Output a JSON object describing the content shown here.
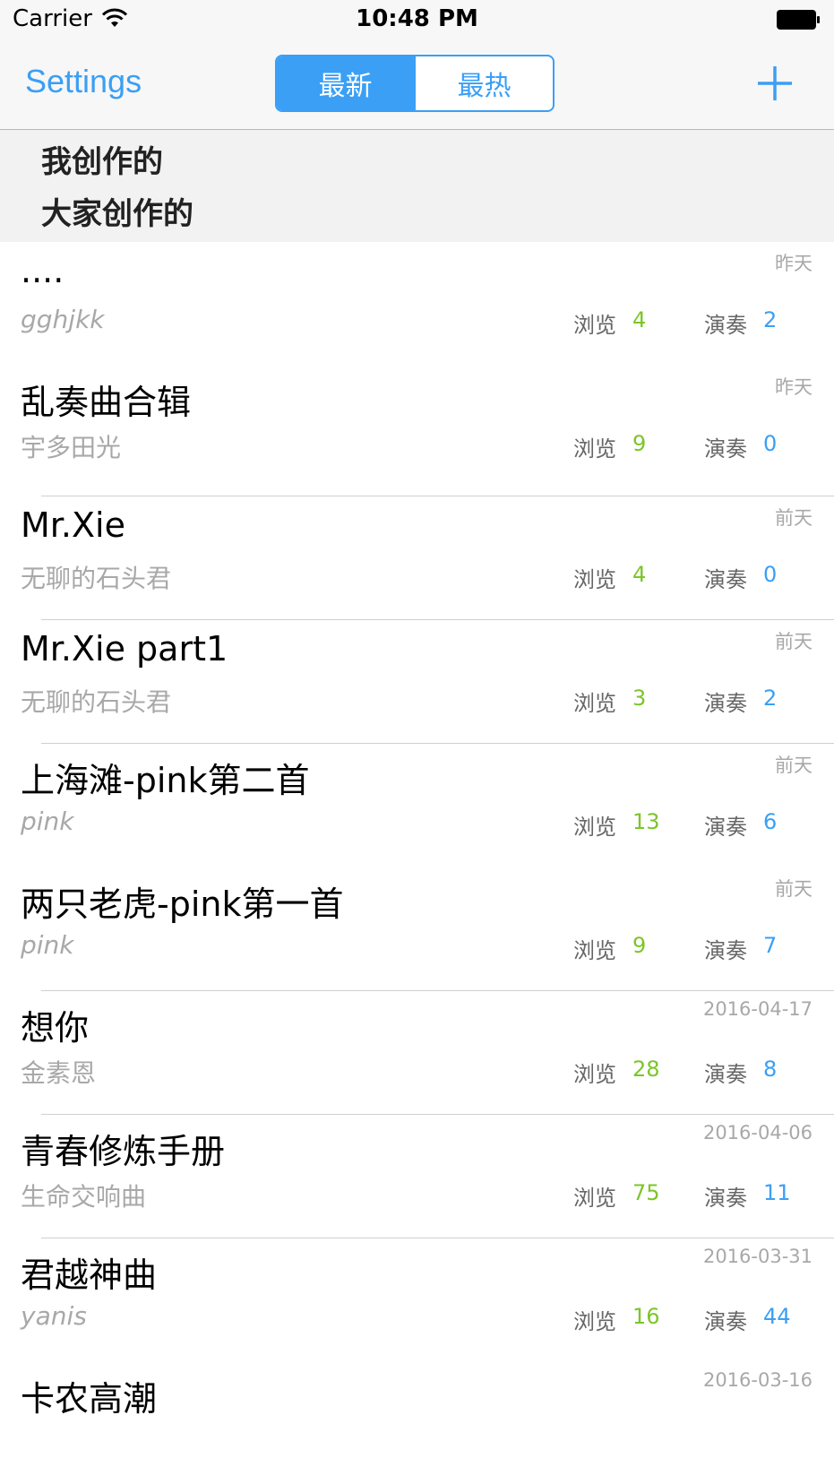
{
  "status_bar": {
    "carrier": "Carrier",
    "time": "10:48 PM"
  },
  "nav": {
    "left_button": "Settings",
    "segments": [
      "最新",
      "最热"
    ],
    "active_segment": 0,
    "right_icon": "plus-icon"
  },
  "filters": [
    "我创作的",
    "大家创作的"
  ],
  "labels": {
    "views": "浏览",
    "plays": "演奏"
  },
  "colors": {
    "accent": "#3a9ff5",
    "views_count": "#7cc52a",
    "secondary_text": "#a8a8a8"
  },
  "songs": [
    {
      "title": "....",
      "author": "gghjkk",
      "date": "昨天",
      "views": "4",
      "plays": "2"
    },
    {
      "title": "乱奏曲合辑",
      "author": "宇多田光",
      "date": "昨天",
      "views": "9",
      "plays": "0"
    },
    {
      "title": "Mr.Xie",
      "author": "无聊的石头君",
      "date": "前天",
      "views": "4",
      "plays": "0"
    },
    {
      "title": "Mr.Xie part1",
      "author": "无聊的石头君",
      "date": "前天",
      "views": "3",
      "plays": "2"
    },
    {
      "title": "上海滩-pink第二首",
      "author": "pink",
      "date": "前天",
      "views": "13",
      "plays": "6"
    },
    {
      "title": "两只老虎-pink第一首",
      "author": "pink",
      "date": "前天",
      "views": "9",
      "plays": "7"
    },
    {
      "title": "想你",
      "author": "金素恩",
      "date": "2016-04-17",
      "views": "28",
      "plays": "8"
    },
    {
      "title": "青春修炼手册",
      "author": "生命交响曲",
      "date": "2016-04-06",
      "views": "75",
      "plays": "11"
    },
    {
      "title": "君越神曲",
      "author": "yanis",
      "date": "2016-03-31",
      "views": "16",
      "plays": "44"
    },
    {
      "title": "卡农高潮",
      "author": "",
      "date": "2016-03-16",
      "views": "",
      "plays": ""
    }
  ]
}
